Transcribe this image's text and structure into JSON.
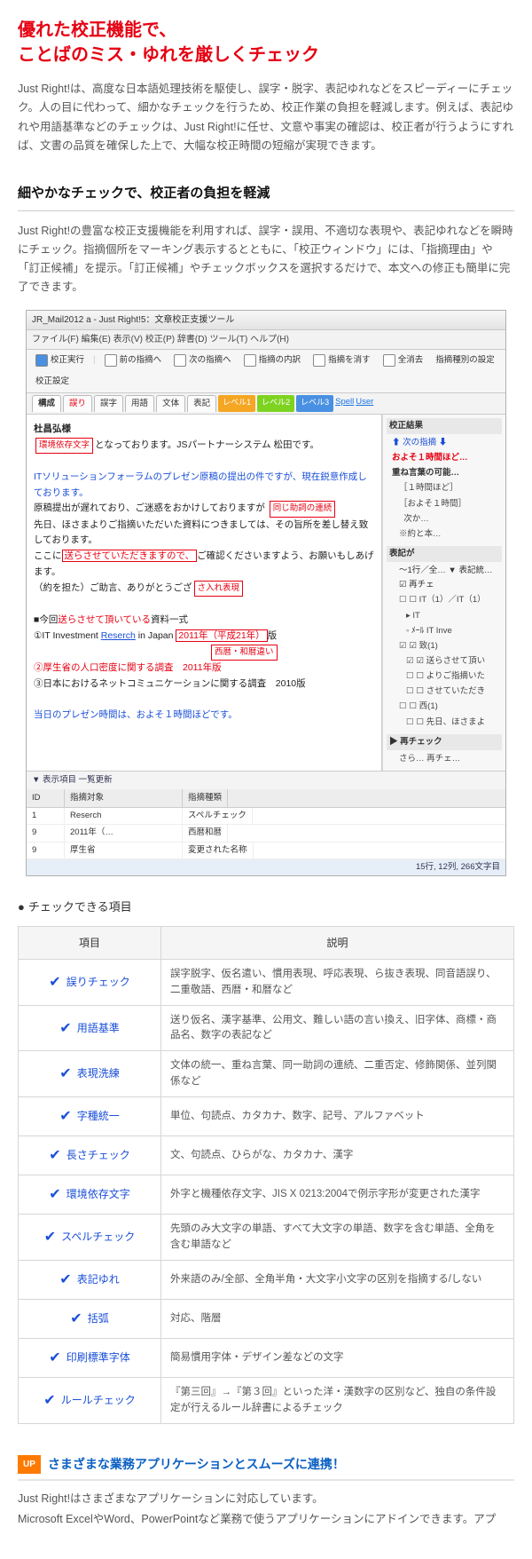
{
  "headline_l1": "優れた校正機能で、",
  "headline_l2": "ことばのミス・ゆれを厳しくチェック",
  "lead": "Just Right!は、高度な日本語処理技術を駆使し、誤字・脱字、表記ゆれなどをスピーディーにチェック。人の目に代わって、細かなチェックを行うため、校正作業の負担を軽減します。例えば、表記ゆれや用語基準などのチェックは、Just Right!に任せ、文意や事実の確認は、校正者が行うようにすれば、文書の品質を確保した上で、大幅な校正時間の短縮が実現できます。",
  "sub1": "細やかなチェックで、校正者の負担を軽減",
  "para1": "Just Right!の豊富な校正支援機能を利用すれば、誤字・誤用、不適切な表現や、表記ゆれなどを瞬時にチェック。指摘個所をマーキング表示するとともに、「校正ウィンドウ」には、「指摘理由」や「訂正候補」を提示。「訂正候補」やチェックボックスを選択するだけで、本文への修正も簡単に完了できます。",
  "app": {
    "title": "JR_Mail2012 a - Just Right!5：文章校正支援ツール",
    "menu": "ファイル(F)  編集(E)  表示(V)  校正(P)  辞書(D)  ツール(T)  ヘルプ(H)",
    "toolbar": {
      "redo": "校正実行",
      "prev": "前の指摘へ",
      "next": "次の指摘へ",
      "detail": "指摘の内訳",
      "del": "指摘を消す",
      "delAll": "全消去",
      "rank": "指摘種別の設定",
      "cfg": "校正設定"
    },
    "tabs": {
      "t1": "構成",
      "t2": "誤り",
      "t3": "誤字",
      "t4": "用語",
      "t5": "文体",
      "t6": "表記",
      "lvl1": "レベル1",
      "lvl2": "レベル2",
      "lvl3": "レベル3",
      "spell": "Spell",
      "user": "User"
    },
    "doc": {
      "greet": "杜昌弘様",
      "env_tag": "環境依存文字",
      "line_env": "となっております。JSパートナーシステム 松田です。",
      "line_forum": "ITソリューションフォーラムのプレゼン原稿の提出の件ですが、現在鋭意作成しております。",
      "line_delay": "原稿提出が遅れており、ご迷惑をおかけしておりますが",
      "same_tag": "同じ助詞の連続",
      "line_apol": "先日、ほさまよりご指摘いただいた資料につきましては、その旨所を差し替え致しております。",
      "line_kura1": "ここに",
      "kura_red": "送らさせていただきますので、",
      "line_kura2": "ご確認くださいますよう、お願いもしあげます。",
      "line_yaku": "（約を担た）ご助言、ありがとうござ",
      "sa_tag": "さ入れ表現",
      "line_list_lead1": "今回",
      "line_list_lead2": "送らさせて頂いている",
      "line_list_lead3": "資料一式",
      "l1a": "①IT Investment ",
      "l1b": "Reserch",
      "l1c": " in Japan ",
      "l1d": "2011年（平成21年）",
      "l1e": "版",
      "era_tag": "西暦・和暦違い",
      "l2": "②厚生省の人口密度に関する調査　2011年版",
      "l3": "③日本におけるネットコミュニケーションに関する調査　2010版",
      "line_time": "当日のプレゼン時間は、およそ１時間ほどです。"
    },
    "side": {
      "h1": "校正結果",
      "p1": "⬆ 次の指摘 ⬇",
      "h2": "およそ１時間ほど…",
      "h3": "重ね言葉の可能…",
      "s1": "［１時間ほど］",
      "s2": "［およそ１時間］",
      "s3": "󠀪 󠀪 次か…",
      "note": "※約と本…",
      "h4": "表記が",
      "r1": "～1行／全… ▼ 表記統… ☑ 再チェ",
      "g1": "☐ IT（1）／IT（1）",
      "g1a": "▸  IT",
      "g1b": "◦ ﾒｰﾙ IT Inve",
      "g2": "☑ 致(1)",
      "g2a": "☑ 送らさせて頂い",
      "g2b": "☐ よりご指摘いた",
      "g2c": "☐ させていただき",
      "g3": "☐ 西(1)",
      "g3a": "☐ 先日、ほさまよ",
      "h5": "▶ 再チェック",
      "foot": "さら… 再チェ…"
    },
    "grid": {
      "h_id": "ID",
      "h_item": "指摘対象",
      "h_kind": "指摘種類",
      "r1_id": "1",
      "r1_a": "Reserch",
      "r1_b": "スペルチェック",
      "r2_id": "9",
      "r2_a": "2011年（…",
      "r2_b": "西暦和暦",
      "r3_id": "9",
      "r3_a": "厚生省",
      "r3_b": "変更された名称"
    },
    "grid_tabs": "▼ 表示項目   一覧更新",
    "status": "15行, 12列, 266文字目"
  },
  "bullet_title": "チェックできる項目",
  "table": {
    "h_item": "項目",
    "h_desc": "説明",
    "rows": [
      {
        "item": "誤りチェック",
        "desc": "誤字脱字、仮名遣い、慣用表現、呼応表現、ら抜き表現、同音語誤り、二重敬語、西暦・和暦など"
      },
      {
        "item": "用語基準",
        "desc": "送り仮名、漢字基準、公用文、難しい語の言い換え、旧字体、商標・商品名、数字の表記など"
      },
      {
        "item": "表現洗練",
        "desc": "文体の統一、重ね言葉、同一助詞の連続、二重否定、修飾関係、並列関係など"
      },
      {
        "item": "字種統一",
        "desc": "単位、句読点、カタカナ、数字、記号、アルファベット"
      },
      {
        "item": "長さチェック",
        "desc": "文、句読点、ひらがな、カタカナ、漢字"
      },
      {
        "item": "環境依存文字",
        "desc": "外字と機種依存文字、JIS X 0213:2004で例示字形が変更された漢字"
      },
      {
        "item": "スペルチェック",
        "desc": "先頭のみ大文字の単語、すべて大文字の単語、数字を含む単語、全角を含む単語など"
      },
      {
        "item": "表記ゆれ",
        "desc": "外来語のみ/全部、全角半角・大文字小文字の区別を指摘する/しない"
      },
      {
        "item": "括弧",
        "desc": "対応、階層"
      },
      {
        "item": "印刷標準字体",
        "desc": "簡易慣用字体・デザイン差などの文字"
      },
      {
        "item": "ルールチェック",
        "desc": "『第三回』→『第３回』といった洋・漢数字の区別など、独自の条件設定が行えるルール辞書によるチェック"
      }
    ]
  },
  "up_badge": "UP",
  "sec2_title": "さまざまな業務アプリケーションとスムーズに連携！",
  "sec2_p1": "Just Right!はさまざまなアプリケーションに対応しています。",
  "sec2_p2": "Microsoft ExcelやWord、PowerPointなど業務で使うアプリケーションにアドインできます。アプ"
}
